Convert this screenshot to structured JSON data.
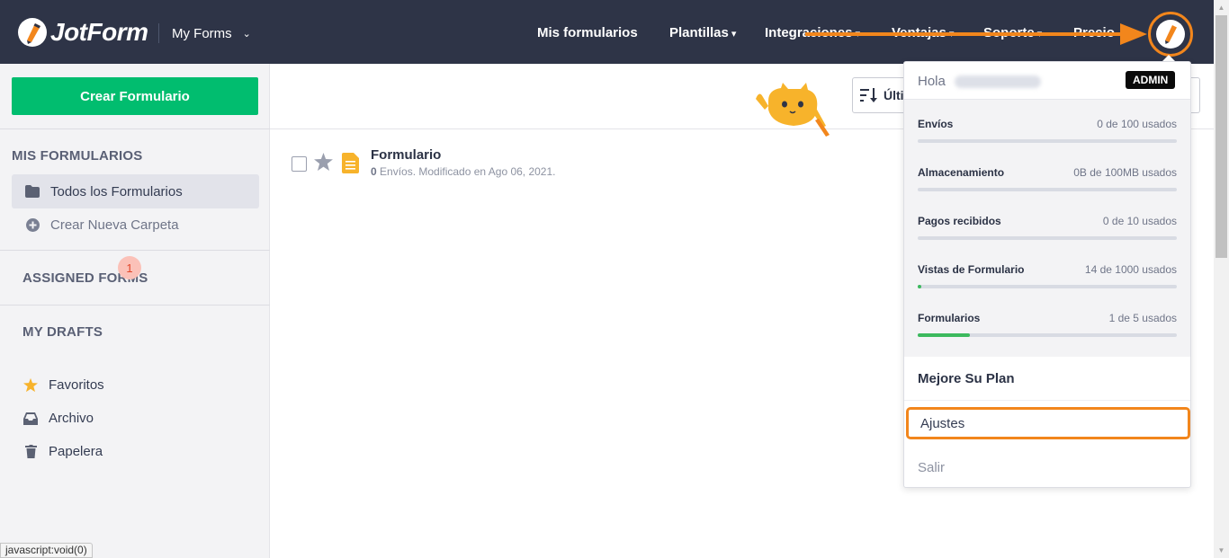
{
  "header": {
    "logo_text": "JotForm",
    "switcher_label": "My Forms",
    "nav": [
      {
        "label": "Mis formularios",
        "caret": false
      },
      {
        "label": "Plantillas",
        "caret": true
      },
      {
        "label": "Integraciones",
        "caret": true
      },
      {
        "label": "Ventajas",
        "caret": true
      },
      {
        "label": "Soporte",
        "caret": true
      },
      {
        "label": "Precio",
        "caret": false
      }
    ],
    "accent_color": "#f2861c",
    "bg_color": "#2e3447"
  },
  "sidebar": {
    "create_button": "Crear Formulario",
    "section_my_forms": "MIS FORMULARIOS",
    "all_forms": "Todos los Formularios",
    "new_folder": "Crear Nueva Carpeta",
    "assigned_forms": "ASSIGNED FORMS",
    "my_drafts": "MY DRAFTS",
    "drafts_count": "1",
    "favorites": "Favoritos",
    "archive": "Archivo",
    "trash": "Papelera"
  },
  "main": {
    "sort_label": "Últi",
    "form": {
      "title": "Formulario",
      "submissions": "0",
      "meta": " Envíos. Modificado en Ago 06, 2021."
    }
  },
  "account_menu": {
    "greeting": "Hola",
    "role_badge": "ADMIN",
    "usage": [
      {
        "label": "Envíos",
        "value": "0 de 100 usados",
        "fraction": 0.0
      },
      {
        "label": "Almacenamiento",
        "value": "0B de 100MB usados",
        "fraction": 0.0
      },
      {
        "label": "Pagos recibidos",
        "value": "0 de 10 usados",
        "fraction": 0.0
      },
      {
        "label": "Vistas de Formulario",
        "value": "14 de 1000 usados",
        "fraction": 0.014
      },
      {
        "label": "Formularios",
        "value": "1 de 5 usados",
        "fraction": 0.2
      }
    ],
    "upgrade": "Mejore Su Plan",
    "settings": "Ajustes",
    "logout": "Salir"
  },
  "status_bar": "javascript:void(0)"
}
